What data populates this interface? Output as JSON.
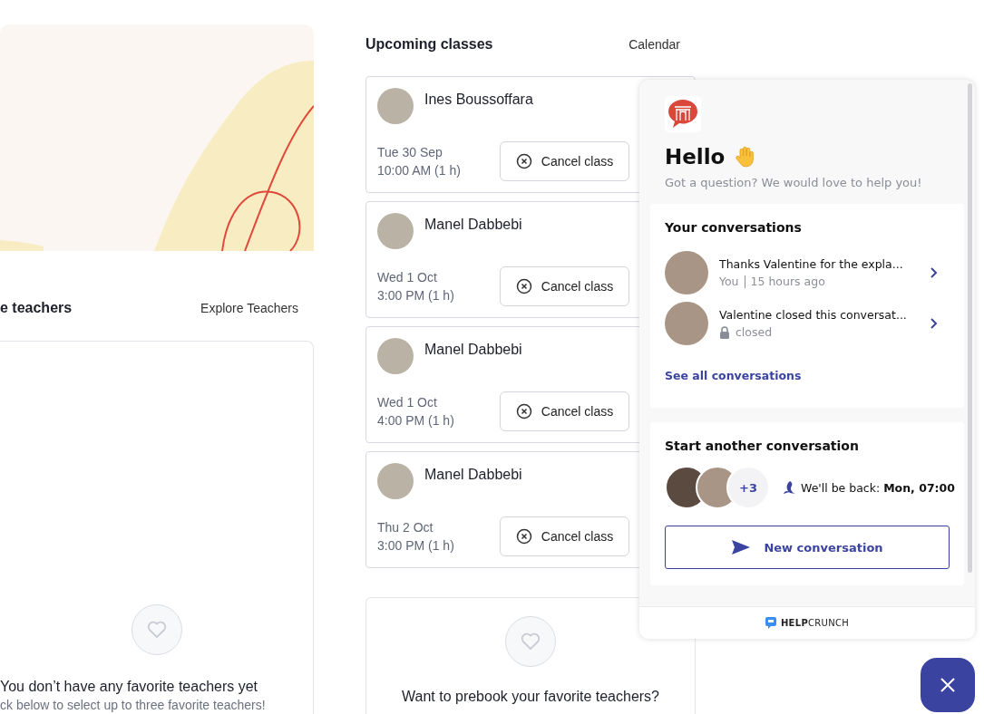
{
  "favorites": {
    "title": "e teachers",
    "link": "Explore Teachers",
    "empty_title": "You don’t have any favorite teachers yet",
    "empty_hint": "ck below to select up to three favorite teachers!"
  },
  "upcoming": {
    "title": "Upcoming classes",
    "link": "Calendar",
    "classes": [
      {
        "teacher": "Ines Boussoffara",
        "date": "Tue 30 Sep",
        "time": "10:00 AM (1 h)",
        "action": "Cancel class"
      },
      {
        "teacher": "Manel Dabbebi",
        "date": "Wed 1 Oct",
        "time": "3:00 PM (1 h)",
        "action": "Cancel class"
      },
      {
        "teacher": "Manel Dabbebi",
        "date": "Wed 1 Oct",
        "time": "4:00 PM (1 h)",
        "action": "Cancel class"
      },
      {
        "teacher": "Manel Dabbebi",
        "date": "Thu 2 Oct",
        "time": "3:00 PM (1 h)",
        "action": "Cancel class"
      }
    ]
  },
  "prebook": {
    "title": "Want to prebook your favorite teachers?"
  },
  "chat": {
    "greeting": "Hello",
    "subtitle": "Got a question? We would love to help you!",
    "conversations": {
      "title": "Your conversations",
      "items": [
        {
          "kind": "recent",
          "message": "Thanks Valentine for the expla...",
          "author": "You",
          "time": "15 hours ago"
        },
        {
          "kind": "closed",
          "message": "Valentine closed this conversat...",
          "status": "closed"
        }
      ],
      "link": "See all conversations"
    },
    "start": {
      "title": "Start another conversation",
      "extra_count": "+3",
      "availability": "We'll be back: **Mon, 07:00**",
      "button": "New conversation"
    },
    "footer": "**HELP**CRUNCH"
  }
}
